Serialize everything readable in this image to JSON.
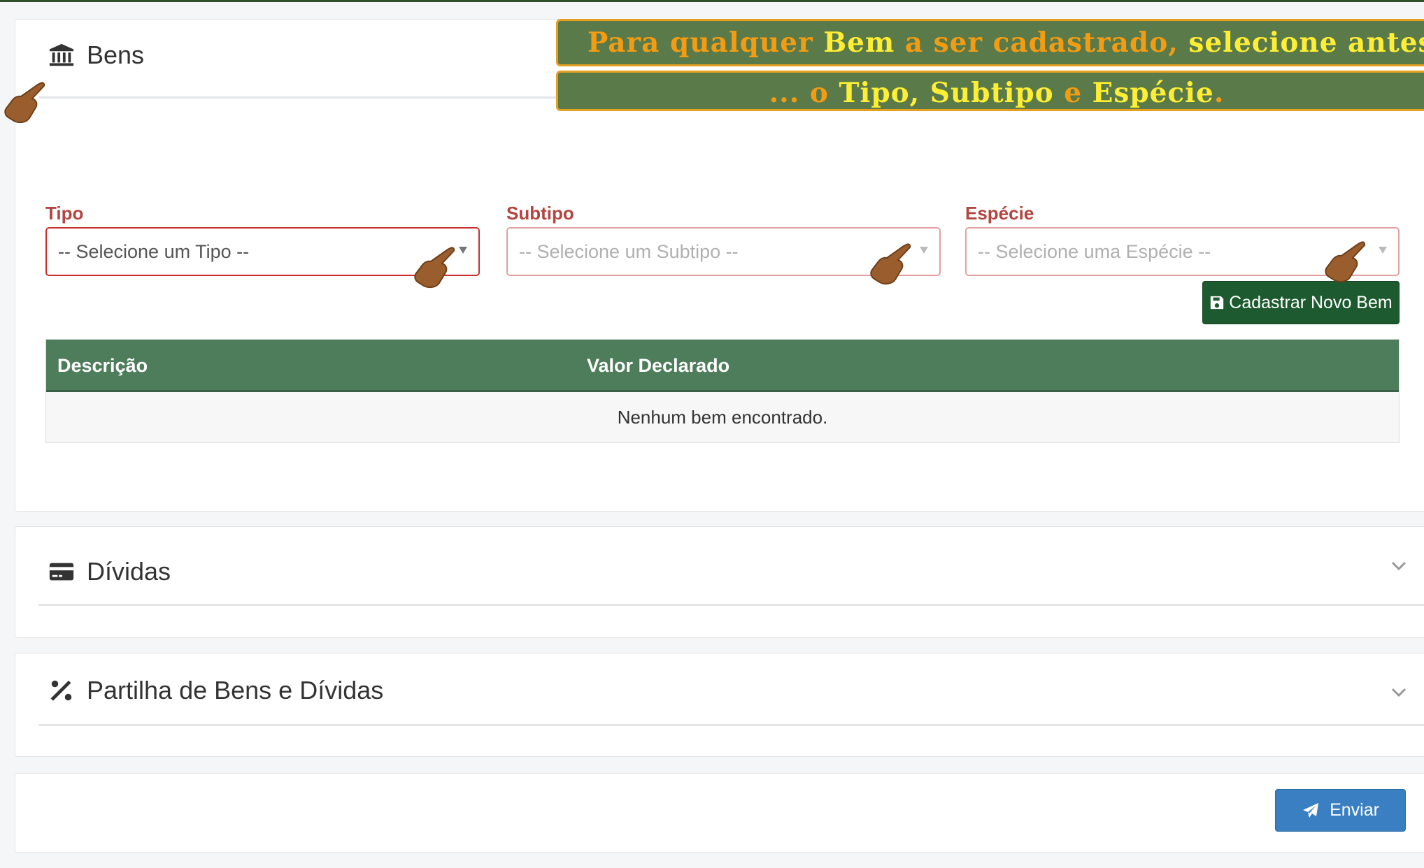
{
  "banner": {
    "line1": [
      {
        "text": "Para qualquer ",
        "color": "orange"
      },
      {
        "text": "Bem",
        "color": "yellow"
      },
      {
        "text": " a ser cadastrado, ",
        "color": "orange"
      },
      {
        "text": "selecione antes",
        "color": "yellow"
      }
    ],
    "line2": [
      {
        "text": "... o ",
        "color": "orange"
      },
      {
        "text": "Tipo, Subtipo",
        "color": "yellow"
      },
      {
        "text": " e ",
        "color": "orange"
      },
      {
        "text": "Espécie",
        "color": "yellow"
      },
      {
        "text": ".",
        "color": "orange"
      }
    ]
  },
  "bens": {
    "title": "Bens",
    "icon": "bank-icon",
    "tipo_label": "Tipo",
    "tipo_placeholder": "-- Selecione um Tipo --",
    "subtipo_label": "Subtipo",
    "subtipo_placeholder": "-- Selecione um Subtipo --",
    "especie_label": "Espécie",
    "especie_placeholder": "-- Selecione uma Espécie --",
    "new_button_label": "Cadastrar Novo Bem",
    "table": {
      "columns": [
        "Descrição",
        "Valor Declarado"
      ],
      "empty_message": "Nenhum bem encontrado."
    }
  },
  "dividas": {
    "title": "Dívidas",
    "icon": "credit-card-icon"
  },
  "partilha": {
    "title": "Partilha de Bens e Dívidas",
    "icon": "percent-icon"
  },
  "footer": {
    "send_label": "Enviar",
    "send_icon": "paper-plane-icon"
  },
  "colors": {
    "primary_green": "#1e5a2f",
    "table_header": "#4e7d5b",
    "label_red": "#b2453f",
    "send_blue": "#3a7fc1",
    "banner_bg": "#5a7a4a",
    "banner_border": "#e6a020",
    "banner_orange": "#f39c12",
    "banner_yellow": "#ffee33"
  }
}
